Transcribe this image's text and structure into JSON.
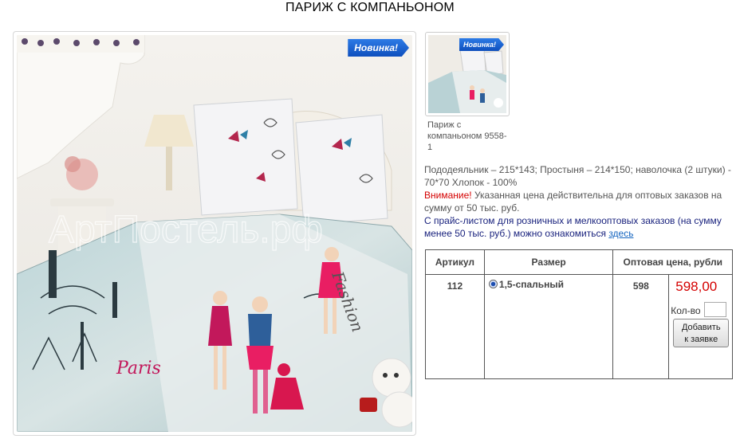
{
  "page": {
    "title": "ПАРИЖ С КОМПАНЬОНОМ"
  },
  "photo": {
    "badge": "Новинка!",
    "watermark": "АртПостель.рф"
  },
  "thumbnail": {
    "badge": "Новинка!",
    "caption": "Париж с компаньоном 9558-1"
  },
  "description": {
    "spec": "Пододеяльник – 215*143; Простыня – 214*150; наволочка (2 штуки) - 70*70 Хлопок - 100%",
    "warning_label": "Внимание!",
    "warning_text": " Указанная цена действительна для оптовых заказов на сумму от 50 тыс. руб.",
    "retail_text": "С прайс-листом для розничных и мелкооптовых заказов (на сумму менее 50 тыс. руб.) можно ознакомиться ",
    "retail_link": "здесь"
  },
  "table": {
    "headers": [
      "Артикул",
      "Размер",
      "Оптовая цена, рубли"
    ],
    "row": {
      "article": "112",
      "size": "1,5-спальный",
      "price_small": "598",
      "price_big": "598,00"
    },
    "qty_label": "Кол-во",
    "add_button_line1": "Добавить",
    "add_button_line2": "к заявке"
  },
  "colors": {
    "price_red": "#d40000",
    "badge_blue": "#0e4fbd",
    "link_blue": "#1565c0"
  }
}
